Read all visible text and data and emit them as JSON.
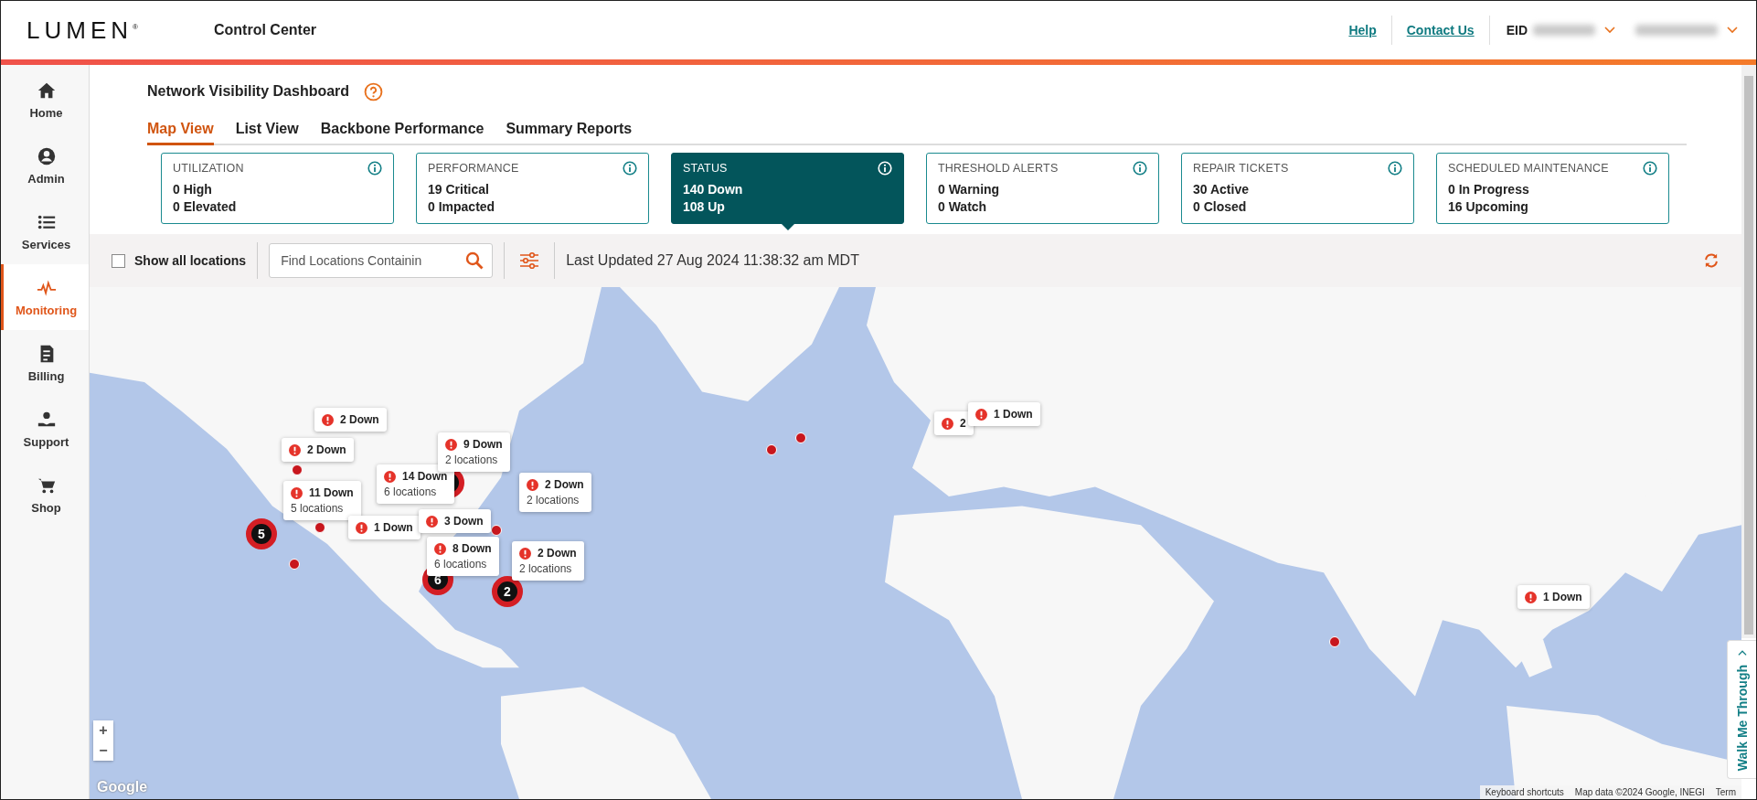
{
  "header": {
    "brand": "LUMEN$^{®}$",
    "app_title": "Control Center",
    "links": [
      {
        "label": "Help"
      },
      {
        "label": "Contact Us"
      }
    ],
    "account_label": "EID"
  },
  "sidebar": {
    "items": [
      {
        "label": "Home",
        "kind": "home",
        "selected": false
      },
      {
        "label": "Admin",
        "kind": "admin",
        "selected": false
      },
      {
        "label": "Services",
        "kind": "services",
        "selected": false
      },
      {
        "label": "Monitoring",
        "kind": "monitoring",
        "selected": true
      },
      {
        "label": "Billing",
        "kind": "billing",
        "selected": false
      },
      {
        "label": "Support",
        "kind": "support",
        "selected": false
      },
      {
        "label": "Shop",
        "kind": "shop",
        "selected": false
      }
    ]
  },
  "dashboard": {
    "title": "Network Visibility Dashboard",
    "tabs": [
      {
        "label": "Map View",
        "selected": true
      },
      {
        "label": "List View",
        "selected": false
      },
      {
        "label": "Backbone Performance",
        "selected": false
      },
      {
        "label": "Summary Reports",
        "selected": false
      }
    ],
    "cards": [
      {
        "title": "UTILIZATION",
        "lines": [
          "0 High",
          "0 Elevated"
        ],
        "selected": false
      },
      {
        "title": "PERFORMANCE",
        "lines": [
          "19 Critical",
          "0 Impacted"
        ],
        "selected": false
      },
      {
        "title": "STATUS",
        "lines": [
          "140 Down",
          "108 Up"
        ],
        "selected": true
      },
      {
        "title": "THRESHOLD ALERTS",
        "lines": [
          "0 Warning",
          "0 Watch"
        ],
        "selected": false
      },
      {
        "title": "REPAIR TICKETS",
        "lines": [
          "30 Active",
          "0 Closed"
        ],
        "selected": false
      },
      {
        "title": "SCHEDULED MAINTENANCE",
        "lines": [
          "0 In Progress",
          "16 Upcoming"
        ],
        "selected": false
      }
    ]
  },
  "toolbar": {
    "show_all": {
      "label": "Show all locations",
      "checked": false
    },
    "search": {
      "placeholder": "Find Locations Containin"
    },
    "last_updated": "Last Updated 27 Aug 2024 11:38:32 am MDT"
  },
  "map": {
    "popups": [
      {
        "title": "2 Down"
      },
      {
        "title": "2 Down"
      },
      {
        "title": "11 Down",
        "subtitle": "5 locations"
      },
      {
        "title": "14 Down",
        "subtitle": "6 locations"
      },
      {
        "title": "9 Down",
        "subtitle": "2 locations"
      },
      {
        "title": "1 Down"
      },
      {
        "title": "3 Down"
      },
      {
        "title": "8 Down",
        "subtitle": "6 locations"
      },
      {
        "title": "2 Down",
        "subtitle": "2 locations"
      },
      {
        "title": "2 Down",
        "subtitle": "2 locations"
      },
      {
        "title": "2"
      },
      {
        "title": "1 Down"
      },
      {
        "title": "1 Down"
      }
    ],
    "clusters": [
      {
        "count": "5"
      },
      {
        "count": "6"
      },
      {
        "count": "2"
      }
    ],
    "zoom_buttons": [
      "+",
      "−"
    ],
    "google_mark": "Google",
    "attributions": [
      "Keyboard shortcuts",
      "Map data ©2024 Google, INEGI",
      "Term"
    ]
  },
  "walkme": {
    "label": "Walk Me Through"
  }
}
